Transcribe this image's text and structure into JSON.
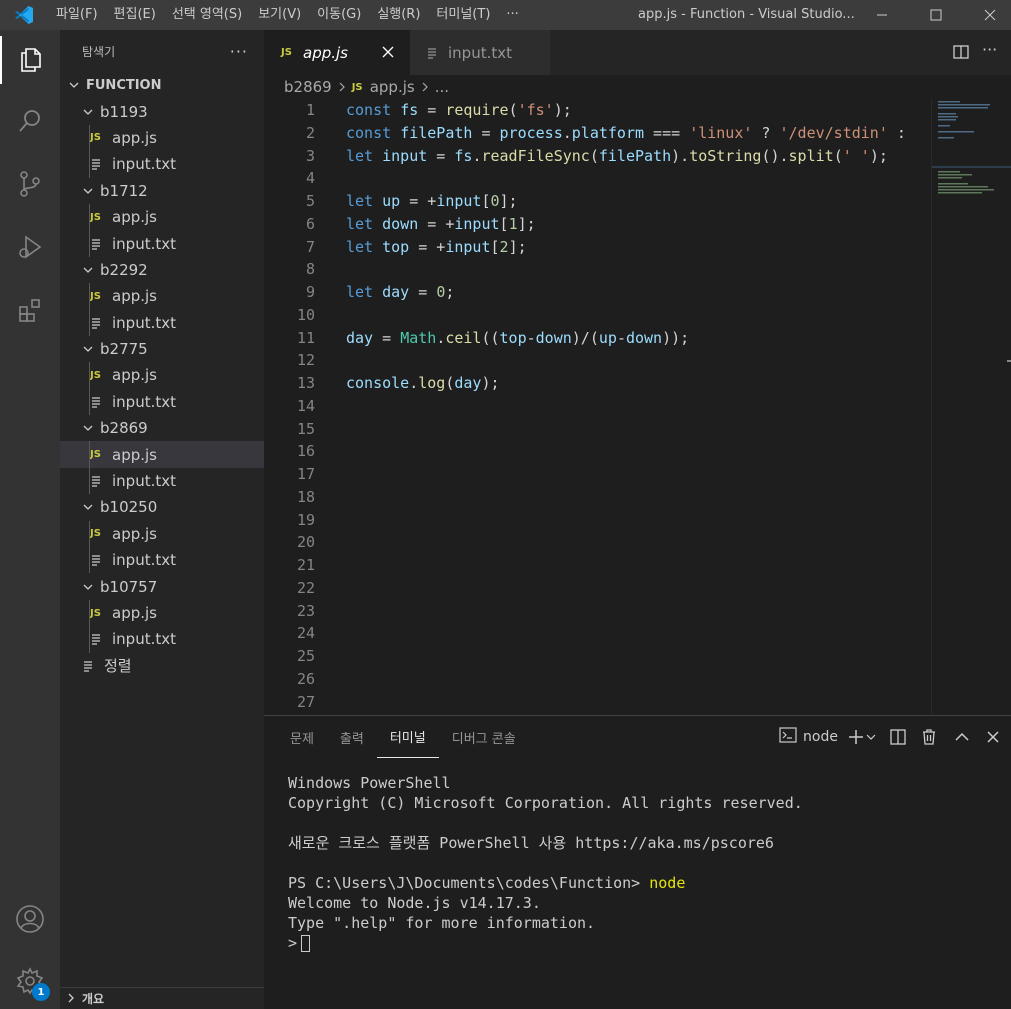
{
  "menu": [
    "파일(F)",
    "편집(E)",
    "선택 영역(S)",
    "보기(V)",
    "이동(G)",
    "실행(R)",
    "터미널(T)",
    "···"
  ],
  "window_title": "app.js - Function - Visual Studio...",
  "activity": [
    "explorer-icon",
    "search-icon",
    "source-control-icon",
    "run-debug-icon",
    "extensions-icon",
    "account-icon",
    "settings-icon"
  ],
  "settings_badge": "1",
  "explorer": {
    "title": "탐색기",
    "more": "···",
    "root": "FUNCTION",
    "folders": [
      {
        "name": "b1193",
        "files": [
          "app.js",
          "input.txt"
        ]
      },
      {
        "name": "b1712",
        "files": [
          "app.js",
          "input.txt"
        ]
      },
      {
        "name": "b2292",
        "files": [
          "app.js",
          "input.txt"
        ]
      },
      {
        "name": "b2775",
        "files": [
          "app.js",
          "input.txt"
        ]
      },
      {
        "name": "b2869",
        "files": [
          "app.js",
          "input.txt"
        ]
      },
      {
        "name": "b10250",
        "files": [
          "app.js",
          "input.txt"
        ]
      },
      {
        "name": "b10757",
        "files": [
          "app.js",
          "input.txt"
        ]
      }
    ],
    "extra_file": "정렬",
    "outline": "개요",
    "js_badge": "JS"
  },
  "tabs": [
    {
      "label": "app.js",
      "active": true
    },
    {
      "label": "input.txt",
      "active": false
    }
  ],
  "breadcrumb": {
    "folder": "b2869",
    "file": "app.js",
    "more": "..."
  },
  "code_lines": [
    "const fs = require('fs');",
    "const filePath = process.platform === 'linux' ? '/dev/stdin' :",
    "let input = fs.readFileSync(filePath).toString().split(' ');",
    "",
    "let up = +input[0];",
    "let down = +input[1];",
    "let top = +input[2];",
    "",
    "let day = 0;",
    "",
    "day = Math.ceil((top-down)/(up-down));",
    "",
    "console.log(day);"
  ],
  "line_count": 27,
  "panel": {
    "tabs": [
      "문제",
      "출력",
      "터미널",
      "디버그 콘솔"
    ],
    "active_tab": "터미널",
    "terminal_name": "node",
    "terminal_lines": [
      "Windows PowerShell",
      "Copyright (C) Microsoft Corporation. All rights reserved.",
      "",
      "새로운 크로스 플랫폼 PowerShell 사용 https://aka.ms/pscore6",
      "",
      "PS C:\\Users\\J\\Documents\\codes\\Function> ",
      "Welcome to Node.js v14.17.3.",
      "Type \".help\" for more information.",
      ">"
    ],
    "typed_command": "node"
  }
}
